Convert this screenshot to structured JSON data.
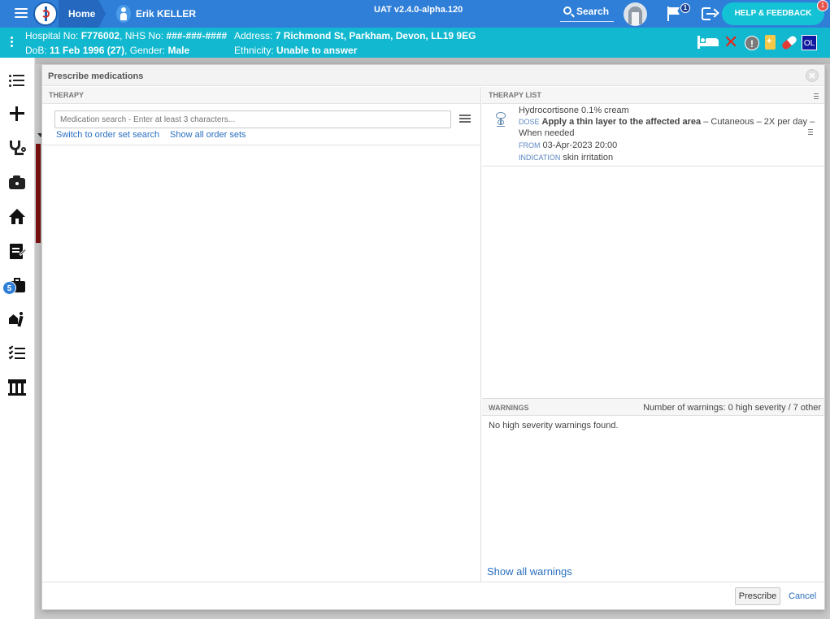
{
  "topbar": {
    "home_label": "Home",
    "user_name": "Erik KELLER",
    "environment": "UAT v2.4.0-alpha.120",
    "search_label": "Search",
    "flag_count": "1",
    "help_label": "HELP & FEEDBACK",
    "help_count": "1",
    "brand_color": "#2f7fd8"
  },
  "patient": {
    "hospital_label": "Hospital No: ",
    "hospital_no": "F776002",
    "nhs_label": ", NHS No: ",
    "nhs_no": "###-###-####",
    "dob_label": "DoB: ",
    "dob": "11 Feb 1996 (27)",
    "gender_label": ", Gender: ",
    "gender": "Male",
    "address_label": "Address: ",
    "address": "7 Richmond St, Parkham, Devon, LL19 9EG",
    "ethnicity_label": "Ethnicity: ",
    "ethnicity": "Unable to answer",
    "alert_symbol": "!",
    "ol_label": "OL",
    "banner_color": "#11b8cf"
  },
  "leftnav": {
    "badge_count": "5",
    "icons": [
      "list-icon",
      "plus-icon",
      "stethoscope-icon",
      "camera-icon",
      "house-icon",
      "document-edit-icon",
      "briefcase-icon",
      "running-person-icon",
      "checklist-icon",
      "building-icon"
    ]
  },
  "dialog": {
    "title": "Prescribe medications",
    "therapy": {
      "header": "THERAPY",
      "search_placeholder": "Medication search - Enter at least 3 characters...",
      "switch_link": "Switch to order set search",
      "show_sets_link": "Show all order sets"
    },
    "therapy_list": {
      "header": "THERAPY LIST",
      "items": [
        {
          "name": "Hydrocortisone 0.1% cream",
          "dose_tag": "DOSE",
          "dose_bold": "Apply a thin layer to the affected area",
          "dose_rest": " – Cutaneous – 2X per day –",
          "dose_cont": "When needed",
          "from_tag": "FROM",
          "from": "03-Apr-2023 20:00",
          "indication_tag": "INDICATION",
          "indication": "skin irritation"
        }
      ]
    },
    "warnings": {
      "header": "WARNINGS",
      "summary": "Number of warnings: 0 high severity / 7 other",
      "text": "No high severity warnings found.",
      "show_all": "Show all warnings"
    },
    "footer": {
      "prescribe_label": "Prescribe",
      "cancel_label": "Cancel"
    }
  }
}
